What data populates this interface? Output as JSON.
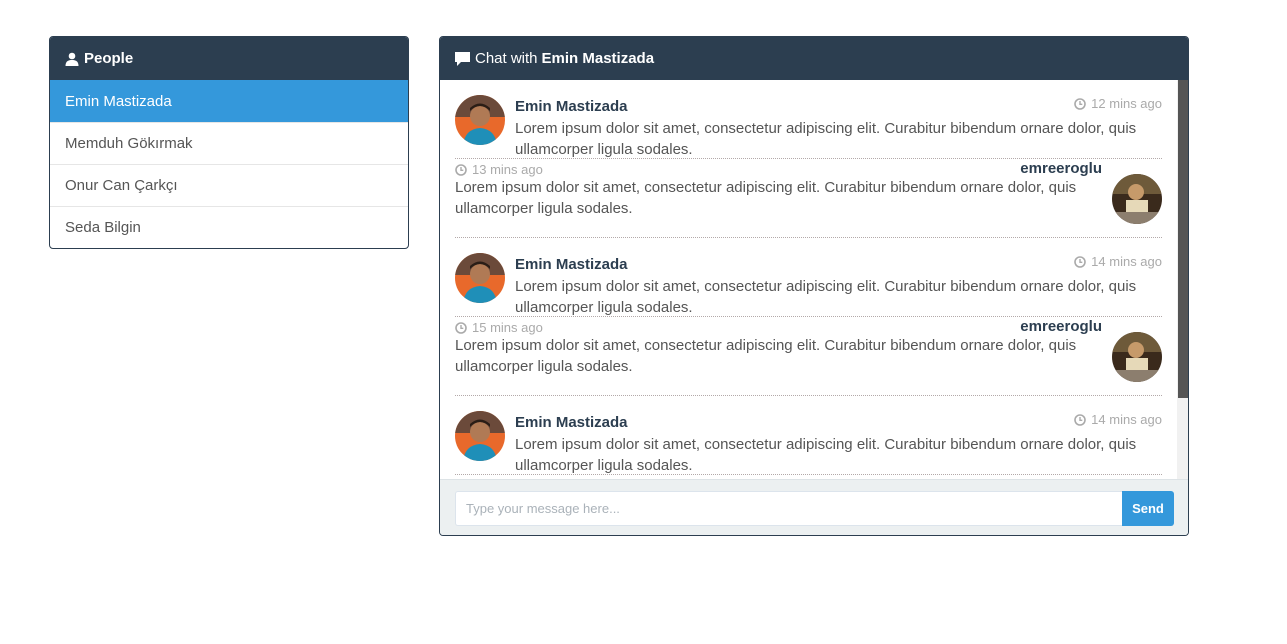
{
  "people_panel": {
    "title": "People",
    "icon": "user-icon",
    "items": [
      {
        "label": "Emin Mastizada",
        "active": true
      },
      {
        "label": "Memduh Gökırmak",
        "active": false
      },
      {
        "label": "Onur Can Çarkçı",
        "active": false
      },
      {
        "label": "Seda Bilgin",
        "active": false
      }
    ]
  },
  "chat_panel": {
    "title_prefix": "Chat with",
    "title_name": "Emin Mastizada",
    "icon": "comment-icon",
    "messages": [
      {
        "side": "left",
        "name": "Emin Mastizada",
        "time": "12 mins ago",
        "text": "Lorem ipsum dolor sit amet, consectetur adipiscing elit. Curabitur bibendum ornare dolor, quis ullamcorper ligula sodales."
      },
      {
        "side": "right",
        "name": "emreeroglu",
        "time": "13 mins ago",
        "text": "Lorem ipsum dolor sit amet, consectetur adipiscing elit. Curabitur bibendum ornare dolor, quis ullamcorper ligula sodales."
      },
      {
        "side": "left",
        "name": "Emin Mastizada",
        "time": "14 mins ago",
        "text": "Lorem ipsum dolor sit amet, consectetur adipiscing elit. Curabitur bibendum ornare dolor, quis ullamcorper ligula sodales."
      },
      {
        "side": "right",
        "name": "emreeroglu",
        "time": "15 mins ago",
        "text": "Lorem ipsum dolor sit amet, consectetur adipiscing elit. Curabitur bibendum ornare dolor, quis ullamcorper ligula sodales."
      },
      {
        "side": "left",
        "name": "Emin Mastizada",
        "time": "14 mins ago",
        "text": "Lorem ipsum dolor sit amet, consectetur adipiscing elit. Curabitur bibendum ornare dolor, quis ullamcorper ligula sodales."
      }
    ],
    "input_placeholder": "Type your message here...",
    "send_label": "Send"
  },
  "colors": {
    "header": "#2c3e50",
    "accent": "#3498db",
    "footer": "#ecf0f1"
  }
}
